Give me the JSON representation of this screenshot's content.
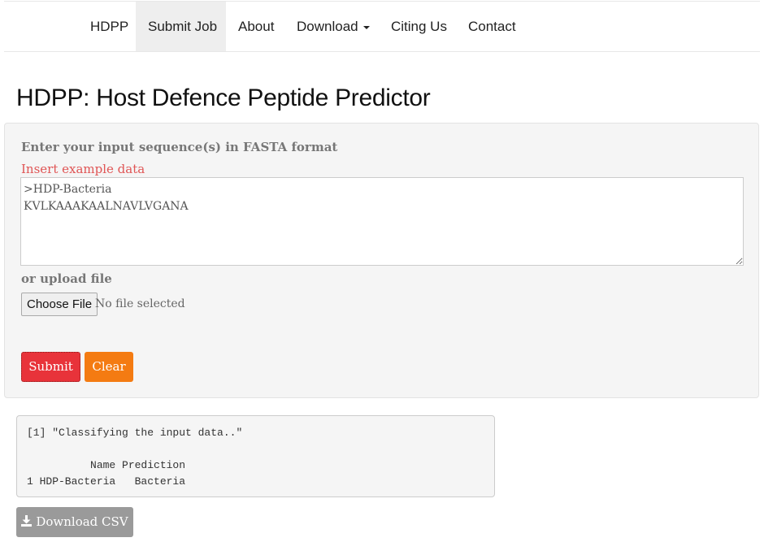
{
  "nav": {
    "items": [
      {
        "label": "HDPP"
      },
      {
        "label": "Submit Job"
      },
      {
        "label": "About"
      },
      {
        "label": "Download"
      },
      {
        "label": "Citing Us"
      },
      {
        "label": "Contact"
      }
    ],
    "active": "Submit Job"
  },
  "page": {
    "title": "HDPP: Host Defence Peptide Predictor"
  },
  "form": {
    "input_label": "Enter your input sequence(s) in FASTA format",
    "example_link": "Insert example data",
    "sequence_value": ">HDP-Bacteria\nKVLKAAAKAALNAVLVGANA",
    "upload_label": "or upload file",
    "choose_file_label": "Choose File",
    "no_file_text": "No file selected",
    "submit_label": "Submit",
    "clear_label": "Clear"
  },
  "output": {
    "lines": [
      "[1] \"Classifying the input data..\"",
      "",
      "          Name Prediction",
      "1 HDP-Bacteria   Bacteria"
    ]
  },
  "download": {
    "label": "Download CSV",
    "icon": "download-icon"
  },
  "colors": {
    "submit": "#e8333a",
    "clear": "#f47b12",
    "download": "#9a9a9a",
    "link": "#e05555"
  }
}
